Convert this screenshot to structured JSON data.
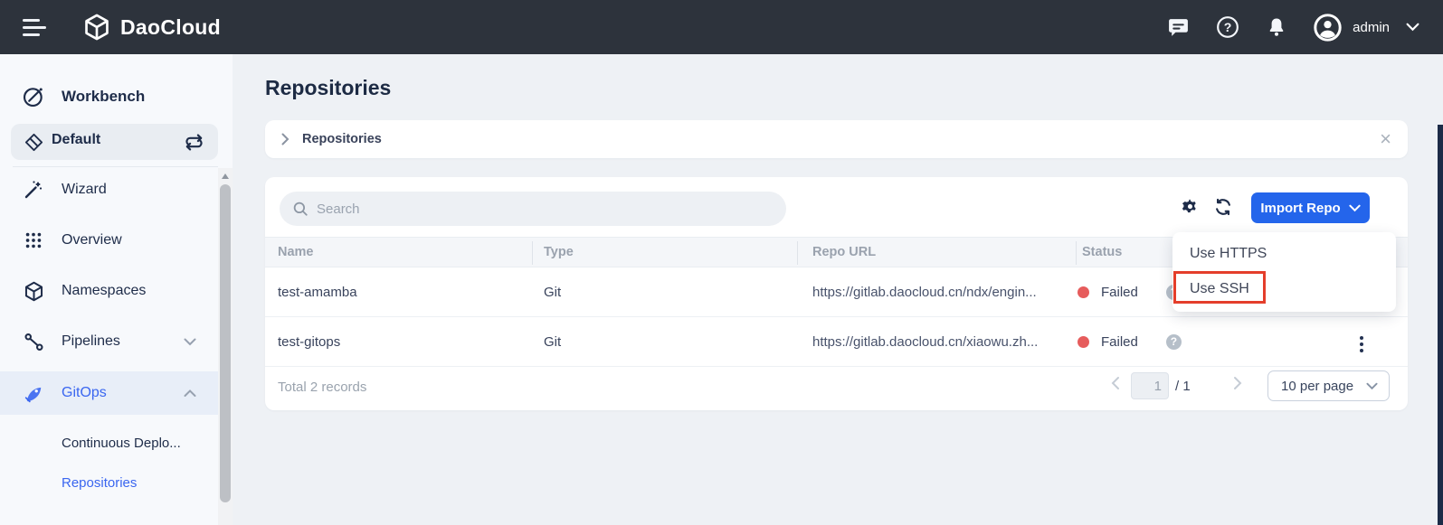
{
  "topbar": {
    "brand": "DaoCloud",
    "user": "admin"
  },
  "sidebar": {
    "workbench": "Workbench",
    "workspace": "Default",
    "items": [
      {
        "label": "Wizard"
      },
      {
        "label": "Overview"
      },
      {
        "label": "Namespaces"
      },
      {
        "label": "Pipelines"
      },
      {
        "label": "GitOps"
      }
    ],
    "subitems": [
      {
        "label": "Continuous Deplo..."
      },
      {
        "label": "Repositories"
      }
    ]
  },
  "page": {
    "title": "Repositories"
  },
  "breadcrumb": {
    "tab": "Repositories"
  },
  "toolbar": {
    "search_placeholder": "Search",
    "import_label": "Import Repo"
  },
  "menu": {
    "items": [
      "Use HTTPS",
      "Use SSH"
    ],
    "highlighted": "Use SSH"
  },
  "table": {
    "columns": [
      "Name",
      "Type",
      "Repo URL",
      "Status"
    ],
    "rows": [
      {
        "name": "test-amamba",
        "type": "Git",
        "url": "https://gitlab.daocloud.cn/ndx/engin...",
        "status": "Failed"
      },
      {
        "name": "test-gitops",
        "type": "Git",
        "url": "https://gitlab.daocloud.cn/xiaowu.zh...",
        "status": "Failed"
      }
    ]
  },
  "pagination": {
    "total": "Total 2 records",
    "page": "1",
    "of": "/ 1",
    "size": "10 per page"
  },
  "icons": {
    "hamburger": "menu bars",
    "logo": "cube",
    "chat": "speech-bubble",
    "help": "question-circle",
    "bell": "notification bell",
    "avatar": "person-circle",
    "search": "magnifier",
    "gear": "settings cog",
    "refresh": "circular arrows",
    "kebab": "vertical dots",
    "close": "x",
    "question": "gray help dot"
  },
  "colors": {
    "topbar": "#2d333c",
    "accent_blue": "#2465eb",
    "active_blue": "#3a66f0",
    "failed_red": "#e65c5c",
    "annotation_red": "#e43e2b",
    "gitops_band": "#e8eef8"
  }
}
